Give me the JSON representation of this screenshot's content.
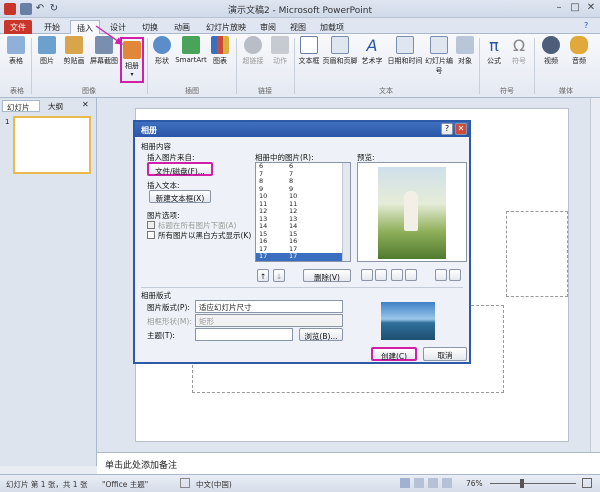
{
  "window": {
    "title": "演示文稿2 - Microsoft PowerPoint"
  },
  "tabs": [
    "文件",
    "开始",
    "插入",
    "设计",
    "切换",
    "动画",
    "幻灯片放映",
    "审阅",
    "视图",
    "加载项"
  ],
  "ribbon": {
    "buttons": [
      "表格",
      "图片",
      "剪贴画",
      "屏幕截图",
      "相册",
      "形状",
      "SmartArt",
      "图表",
      "超链接",
      "动作",
      "文本框",
      "页眉和页脚",
      "艺术字",
      "日期和时间",
      "幻灯片编号",
      "对象",
      "公式",
      "符号",
      "视频",
      "音频"
    ],
    "groups": [
      "表格",
      "图像",
      "插图",
      "链接",
      "文本",
      "符号",
      "媒体"
    ]
  },
  "panes": {
    "tab_slides": "幻灯片",
    "tab_outline": "大纲",
    "close": "✕",
    "thumb_num": "1"
  },
  "notes": "单击此处添加备注",
  "status": {
    "slide": "幻灯片 第 1 张，共 1 张",
    "theme": "\"Office 主题\"",
    "lang": "中文(中国)",
    "zoom": "76%"
  },
  "dialog": {
    "title": "相册",
    "help": "?",
    "close": "✕",
    "content_label": "相册内容",
    "source_label": "插入图片来自:",
    "file_btn": "文件/磁盘(F)...",
    "insert_text_label": "插入文本:",
    "new_textbox_btn": "新建文本框(X)",
    "pic_options_label": "图片选项:",
    "caption_opt": "标题在所有图片下面(A)",
    "bw_opt": "所有图片以黑白方式显示(K)",
    "pictures_label": "相册中的图片(R):",
    "pictures": [
      [
        "6",
        "6"
      ],
      [
        "7",
        "7"
      ],
      [
        "8",
        "8"
      ],
      [
        "9",
        "9"
      ],
      [
        "10",
        "10"
      ],
      [
        "11",
        "11"
      ],
      [
        "12",
        "12"
      ],
      [
        "13",
        "13"
      ],
      [
        "14",
        "14"
      ],
      [
        "15",
        "15"
      ],
      [
        "16",
        "16"
      ],
      [
        "17",
        "17"
      ],
      [
        "17",
        "17"
      ]
    ],
    "order_up": "↑",
    "order_down": "↓",
    "remove_btn": "删除(V)",
    "preview_label": "预览:",
    "layout_label": "相册版式",
    "pic_layout_label": "图片版式(P):",
    "pic_layout_value": "适应幻灯片尺寸",
    "frame_label": "相框形状(M):",
    "frame_value": "矩形",
    "theme_label": "主题(T):",
    "theme_value": "",
    "browse_btn": "浏览(B)...",
    "create_btn": "创建(C)",
    "cancel_btn": "取消"
  },
  "colors": {
    "accent": "#d21fa8",
    "file_tab": "#c8352b",
    "dialog_title": "#2a56a6"
  }
}
